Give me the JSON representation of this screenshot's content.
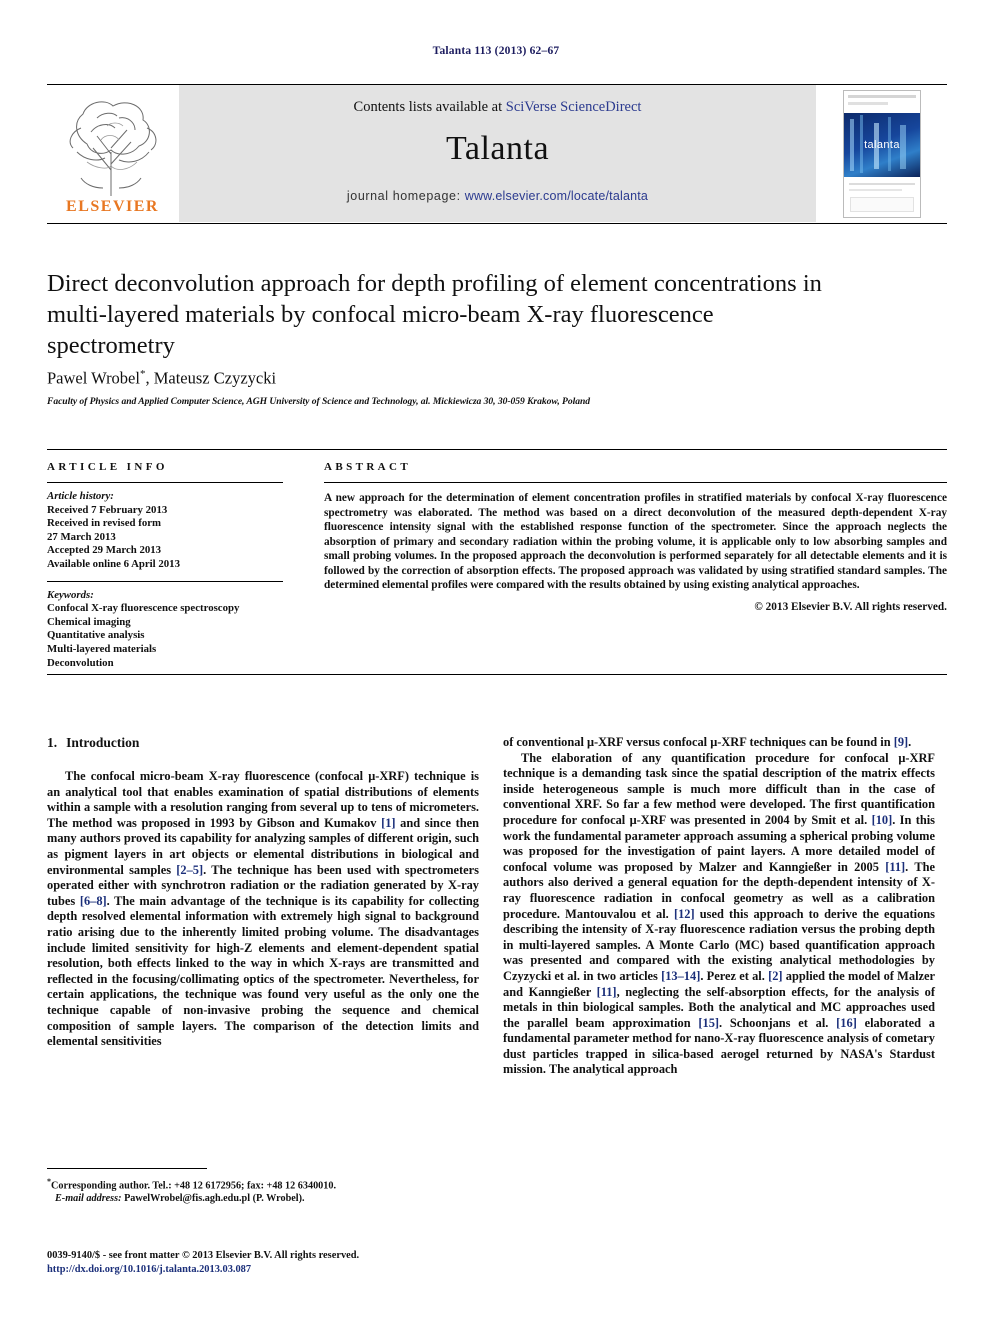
{
  "running_head": "Talanta 113 (2013) 62–67",
  "masthead": {
    "contents_prefix": "Contents lists available at ",
    "contents_link": "SciVerse ScienceDirect",
    "journal_name": "Talanta",
    "homepage_prefix": "journal homepage: ",
    "homepage_link": "www.elsevier.com/locate/talanta",
    "publisher": "ELSEVIER",
    "cover_title": "talanta"
  },
  "article": {
    "title": "Direct deconvolution approach for depth profiling of element concentrations in multi-layered materials by confocal micro-beam X-ray fluorescence spectrometry",
    "authors": "Pawel Wrobel",
    "authors_marker": "*",
    "authors_rest": ", Mateusz Czyzycki",
    "affiliation": "Faculty of Physics and Applied Computer Science, AGH University of Science and Technology, al. Mickiewicza 30, 30-059 Krakow, Poland"
  },
  "article_info": {
    "heading": "ARTICLE INFO",
    "history_label": "Article history:",
    "history": [
      "Received 7 February 2013",
      "Received in revised form",
      "27 March 2013",
      "Accepted 29 March 2013",
      "Available online 6 April 2013"
    ],
    "keywords_label": "Keywords:",
    "keywords": [
      "Confocal X-ray fluorescence spectroscopy",
      "Chemical imaging",
      "Quantitative analysis",
      "Multi-layered materials",
      "Deconvolution"
    ]
  },
  "abstract": {
    "heading": "ABSTRACT",
    "text": "A new approach for the determination of element concentration profiles in stratified materials by confocal X-ray fluorescence spectrometry was elaborated. The method was based on a direct deconvolution of the measured depth-dependent X-ray fluorescence intensity signal with the established response function of the spectrometer. Since the approach neglects the absorption of primary and secondary radiation within the probing volume, it is applicable only to low absorbing samples and small probing volumes. In the proposed approach the deconvolution is performed separately for all detectable elements and it is followed by the correction of absorption effects. The proposed approach was validated by using stratified standard samples. The determined elemental profiles were compared with the results obtained by using existing analytical approaches.",
    "copyright": "© 2013 Elsevier B.V. All rights reserved."
  },
  "introduction": {
    "number": "1.",
    "heading": "Introduction",
    "left_p1_a": "The confocal micro-beam X-ray fluorescence (confocal μ-XRF) technique is an analytical tool that enables examination of spatial distributions of elements within a sample with a resolution ranging from several up to tens of micrometers. The method was proposed in 1993 by Gibson and Kumakov ",
    "left_ref1": "[1]",
    "left_p1_b": " and since then many authors proved its capability for analyzing samples of different origin, such as pigment layers in art objects or elemental distributions in biological and environmental samples ",
    "left_ref2": "[2–5]",
    "left_p1_c": ". The technique has been used with spectrometers operated either with synchrotron radiation or the radiation generated by X-ray tubes ",
    "left_ref3": "[6–8]",
    "left_p1_d": ". The main advantage of the technique is its capability for collecting depth resolved elemental information with extremely high signal to background ratio arising due to the inherently limited probing volume. The disadvantages include limited sensitivity for high-Z elements and element-dependent spatial resolution, both effects linked to the way in which X-rays are transmitted and reflected in the focusing/collimating optics of the spectrometer. Nevertheless, for certain applications, the technique was found very useful as the only one the technique capable of non-invasive probing the sequence and chemical composition of sample layers. The comparison of the detection limits and elemental sensitivities",
    "right_p0_a": "of conventional μ-XRF versus confocal μ-XRF techniques can be found in ",
    "right_ref9": "[9]",
    "right_p0_b": ".",
    "right_p1_a": "The elaboration of any quantification procedure for confocal μ-XRF technique is a demanding task since the spatial description of the matrix effects inside heterogeneous sample is much more difficult than in the case of conventional XRF. So far a few method were developed. The first quantification procedure for confocal μ-XRF was presented in 2004 by Smit et al. ",
    "right_ref10": "[10]",
    "right_p1_b": ". In this work the fundamental parameter approach assuming a spherical probing volume was proposed for the investigation of paint layers. A more detailed model of confocal volume was proposed by Malzer and Kanngießer in 2005 ",
    "right_ref11": "[11]",
    "right_p1_c": ". The authors also derived a general equation for the depth-dependent intensity of X-ray fluorescence radiation in confocal geometry as well as a calibration procedure. Mantouvalou et al. ",
    "right_ref12": "[12]",
    "right_p1_d": " used this approach to derive the equations describing the intensity of X-ray fluorescence radiation versus the probing depth in multi-layered samples. A Monte Carlo (MC) based quantification approach was presented and compared with the existing analytical methodologies by Czyzycki et al. in two articles ",
    "right_ref13": "[13–14]",
    "right_p1_e": ". Perez et al. ",
    "right_ref2b": "[2]",
    "right_p1_f": " applied the model of Malzer and Kanngießer ",
    "right_ref11b": "[11]",
    "right_p1_g": ", neglecting the self-absorption effects, for the analysis of metals in thin biological samples. Both the analytical and MC approaches used the parallel beam approximation ",
    "right_ref15": "[15]",
    "right_p1_h": ". Schoonjans et al. ",
    "right_ref16": "[16]",
    "right_p1_i": " elaborated a fundamental parameter method for nano-X-ray fluorescence analysis of cometary dust particles trapped in silica-based aerogel returned by NASA's Stardust mission. The analytical approach"
  },
  "footnote": {
    "marker": "*",
    "line1": "Corresponding author. Tel.: +48 12 6172956; fax: +48 12 6340010.",
    "email_label": "E-mail address:",
    "email": " PawelWrobel@fis.agh.edu.pl (P. Wrobel)."
  },
  "footer": {
    "line1": "0039-9140/$ - see front matter © 2013 Elsevier B.V. All rights reserved.",
    "doi": "http://dx.doi.org/10.1016/j.talanta.2013.03.087"
  }
}
